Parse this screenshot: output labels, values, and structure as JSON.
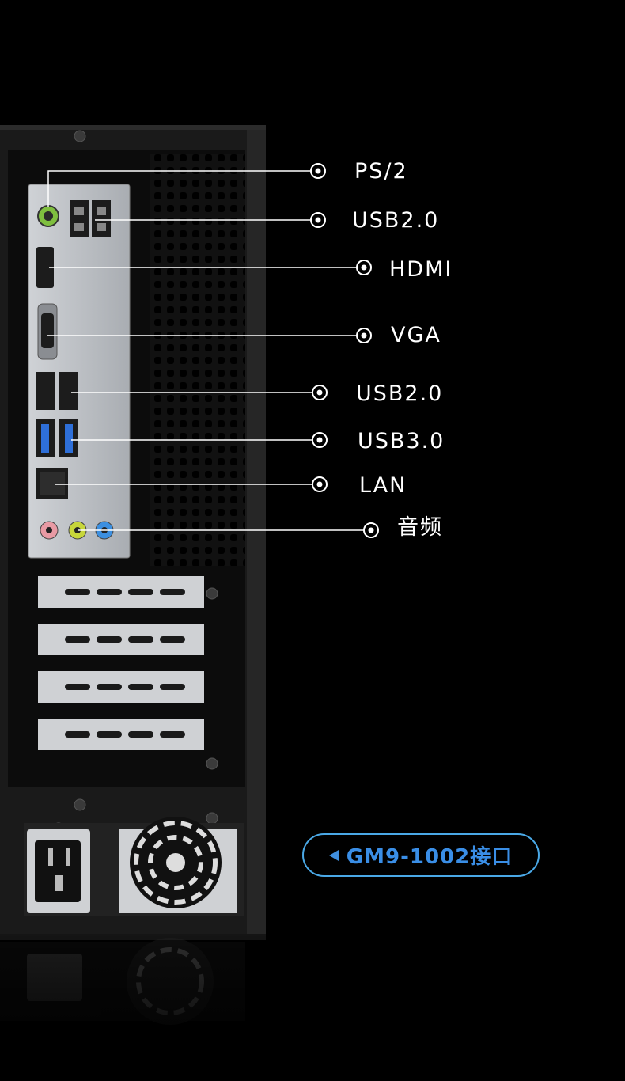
{
  "labels": {
    "ps2": "PS/2",
    "usb20_top": "USB2.0",
    "hdmi": "HDMI",
    "vga": "VGA",
    "usb20_mid": "USB2.0",
    "usb30": "USB3.0",
    "lan": "LAN",
    "audio": "音频"
  },
  "badge": {
    "text": "GM9-1002接口",
    "icon": "triangle-left-icon"
  },
  "colors": {
    "accent": "#3a8ee6",
    "badge_border": "#4aa8e6",
    "background": "#000000"
  }
}
